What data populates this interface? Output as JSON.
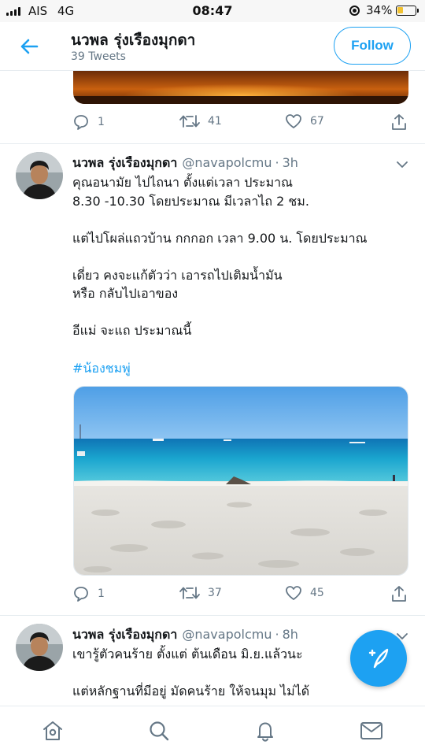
{
  "status_bar": {
    "carrier": "AIS",
    "network": "4G",
    "time": "08:47",
    "battery_percent": "34%",
    "battery_level": 0.34,
    "icons": [
      "signal-icon",
      "orientation-lock-icon",
      "battery-icon"
    ]
  },
  "header": {
    "back_icon": "back-arrow-icon",
    "name": "นวพล รุ่งเรืองมุกดา",
    "tweet_count": "39 Tweets",
    "follow_label": "Follow"
  },
  "top_tweet": {
    "image": "sunset-photo",
    "actions": {
      "replies": "1",
      "retweets": "41",
      "likes": "67"
    }
  },
  "tweet_1": {
    "author": "นวพล รุ่งเรืองมุกดา",
    "handle": "@navapolcmu",
    "separator": "·",
    "time": "3h",
    "text": "คุณอนามัย ไปไถนา ตั้งแต่เวลา ประมาณ\n8.30 -10.30 โดยประมาณ มีเวลาไถ 2 ชม.\n\nแต่ไปโผล่แถวบ้าน กกกอก  เวลา 9.00 น. โดยประมาณ\n\nเดี่ยว คงจะแก้ตัวว่า เอารถไปเติมน้ำมัน\nหรือ กลับไปเอาของ\n\nอีแม่ จะแถ ประมาณนี้",
    "hashtag": "#น้องชมพู่",
    "image": "beach-photo",
    "actions": {
      "replies": "1",
      "retweets": "37",
      "likes": "45"
    }
  },
  "tweet_2": {
    "author": "นวพล รุ่งเรืองมุกดา",
    "handle": "@navapolcmu",
    "separator": "·",
    "time": "8h",
    "text": "เขารู้ตัวคนร้าย ตั้งแต่ ต้นเดือน มิ.ย.แล้วนะ\n\nแต่หลักฐานที่มีอยู่ มัดคนร้าย ให้จนมุม ไม่ได้"
  },
  "fab": {
    "icon": "compose-tweet-icon"
  },
  "bottom_nav": {
    "items": [
      "home-icon",
      "search-icon",
      "notifications-icon",
      "messages-icon"
    ]
  },
  "colors": {
    "accent": "#1da1f2",
    "text": "#14171a",
    "muted": "#657786",
    "divider": "#e6ecf0"
  }
}
